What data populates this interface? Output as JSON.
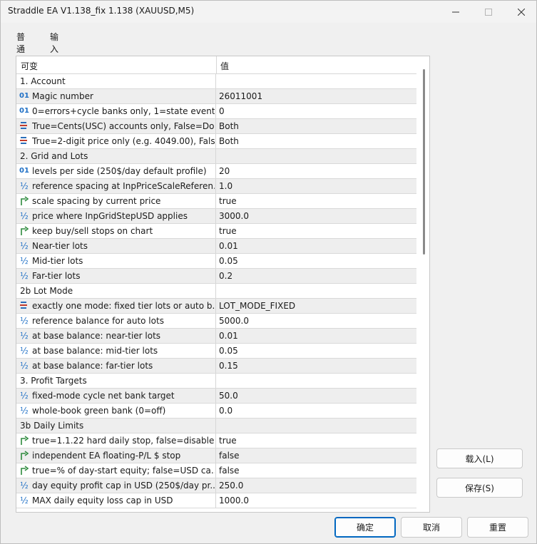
{
  "window": {
    "title": "Straddle EA V1.138_fix 1.138 (XAUUSD,M5)"
  },
  "tabs": [
    {
      "label": "普通",
      "active": false
    },
    {
      "label": "输入",
      "active": true
    }
  ],
  "grid": {
    "col_variable": "可变",
    "col_value": "值",
    "rows": [
      {
        "type": "section",
        "label": "1. Account",
        "value": ""
      },
      {
        "type": "param",
        "icon": "int-icon",
        "icon_text": "01",
        "label": "Magic number",
        "value": "26011001"
      },
      {
        "type": "param",
        "icon": "int-icon",
        "icon_text": "01",
        "label": "0=errors+cycle banks only, 1=state event...",
        "value": "0"
      },
      {
        "type": "param",
        "icon": "enum-icon",
        "icon_text": "",
        "label": "True=Cents(USC) accounts only, False=Do...",
        "value": "Both"
      },
      {
        "type": "param",
        "icon": "enum-icon",
        "icon_text": "",
        "label": "True=2-digit price only (e.g. 4049.00), Fals...",
        "value": "Both"
      },
      {
        "type": "section",
        "label": "2. Grid and Lots",
        "value": ""
      },
      {
        "type": "param",
        "icon": "int-icon",
        "icon_text": "01",
        "label": "levels per side (250$/day default profile)",
        "value": "20"
      },
      {
        "type": "param",
        "icon": "double-icon",
        "icon_text": "½",
        "label": "reference spacing at InpPriceScaleReferen...",
        "value": "1.0"
      },
      {
        "type": "param",
        "icon": "bool-icon",
        "icon_text": "",
        "label": "scale spacing by current price",
        "value": "true"
      },
      {
        "type": "param",
        "icon": "double-icon",
        "icon_text": "½",
        "label": "price where InpGridStepUSD applies",
        "value": "3000.0"
      },
      {
        "type": "param",
        "icon": "bool-icon",
        "icon_text": "",
        "label": "keep buy/sell stops on chart",
        "value": "true"
      },
      {
        "type": "param",
        "icon": "double-icon",
        "icon_text": "½",
        "label": "Near-tier lots",
        "value": "0.01"
      },
      {
        "type": "param",
        "icon": "double-icon",
        "icon_text": "½",
        "label": "Mid-tier lots",
        "value": "0.05"
      },
      {
        "type": "param",
        "icon": "double-icon",
        "icon_text": "½",
        "label": "Far-tier lots",
        "value": "0.2"
      },
      {
        "type": "section",
        "label": "2b Lot Mode",
        "value": ""
      },
      {
        "type": "param",
        "icon": "enum-icon",
        "icon_text": "",
        "label": "exactly one mode: fixed tier lots or auto b...",
        "value": "LOT_MODE_FIXED"
      },
      {
        "type": "param",
        "icon": "double-icon",
        "icon_text": "½",
        "label": "reference balance for auto lots",
        "value": "5000.0"
      },
      {
        "type": "param",
        "icon": "double-icon",
        "icon_text": "½",
        "label": "at base balance: near-tier lots",
        "value": "0.01"
      },
      {
        "type": "param",
        "icon": "double-icon",
        "icon_text": "½",
        "label": "at base balance: mid-tier lots",
        "value": "0.05"
      },
      {
        "type": "param",
        "icon": "double-icon",
        "icon_text": "½",
        "label": "at base balance: far-tier lots",
        "value": "0.15"
      },
      {
        "type": "section",
        "label": "3. Profit Targets",
        "value": ""
      },
      {
        "type": "param",
        "icon": "double-icon",
        "icon_text": "½",
        "label": "fixed-mode cycle net bank target",
        "value": "50.0"
      },
      {
        "type": "param",
        "icon": "double-icon",
        "icon_text": "½",
        "label": "whole-book green bank (0=off)",
        "value": "0.0"
      },
      {
        "type": "section",
        "label": "3b Daily Limits",
        "value": ""
      },
      {
        "type": "param",
        "icon": "bool-icon",
        "icon_text": "",
        "label": "true=1.1.22 hard daily stop, false=disable...",
        "value": "true"
      },
      {
        "type": "param",
        "icon": "bool-icon",
        "icon_text": "",
        "label": "independent EA floating-P/L $ stop",
        "value": "false"
      },
      {
        "type": "param",
        "icon": "bool-icon",
        "icon_text": "",
        "label": "true=% of day-start equity; false=USD ca...",
        "value": "false"
      },
      {
        "type": "param",
        "icon": "double-icon",
        "icon_text": "½",
        "label": "day equity profit cap in USD (250$/day pr...",
        "value": "250.0"
      },
      {
        "type": "param",
        "icon": "double-icon",
        "icon_text": "½",
        "label": "MAX daily equity loss cap in USD",
        "value": "1000.0"
      }
    ]
  },
  "buttons": {
    "load": "载入(L)",
    "save": "保存(S)",
    "ok": "确定",
    "cancel": "取消",
    "reset": "重置"
  },
  "colors": {
    "accent": "#0067c0",
    "icon_blue": "#1e6fc5",
    "icon_green": "#2e8b3e"
  }
}
